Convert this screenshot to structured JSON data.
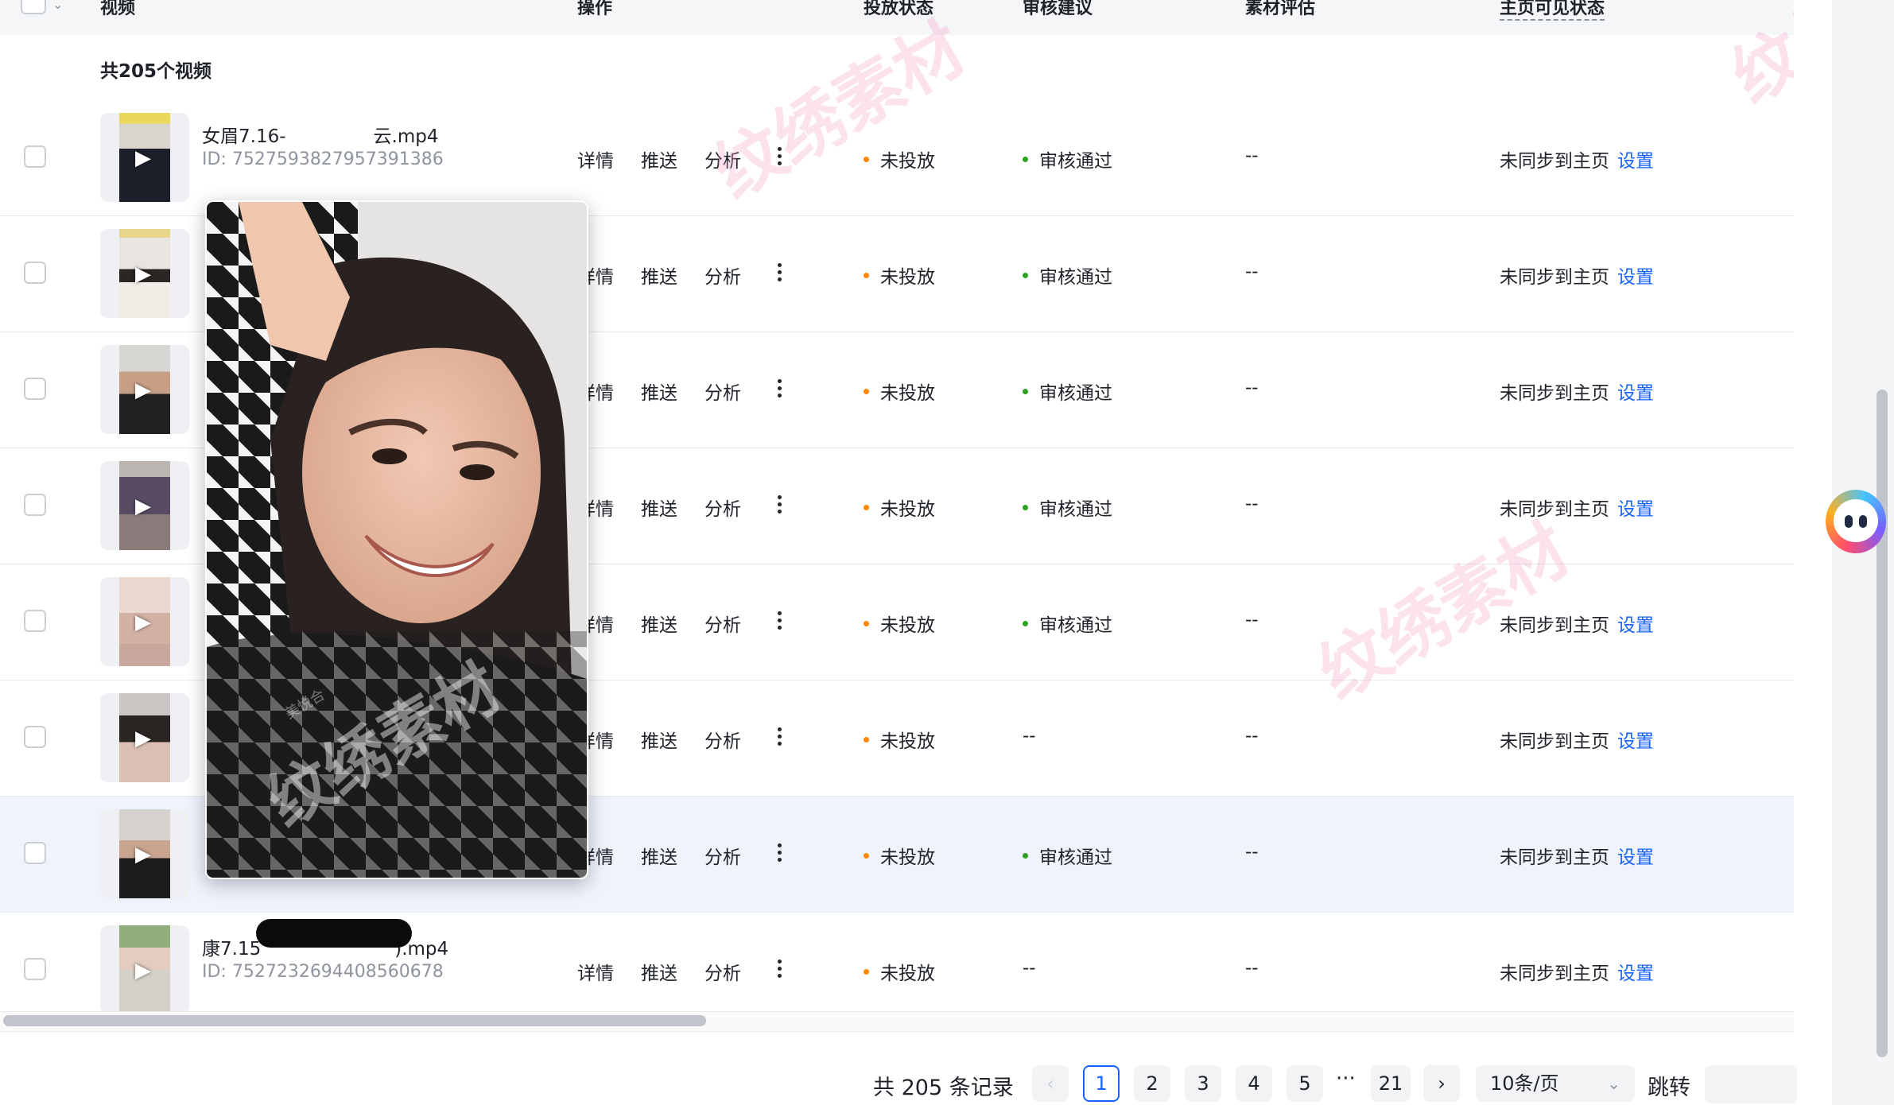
{
  "header": {
    "columns": [
      "视频",
      "操作",
      "投放状态",
      "审核建议",
      "素材评估",
      "主页可见状态"
    ]
  },
  "summary": "共205个视频",
  "actions": {
    "detail": "详情",
    "push": "推送",
    "analysis": "分析"
  },
  "rows": [
    {
      "filename": "女眉7.16-",
      "filename_tail": "云.mp4",
      "id": "ID: 7527593827957391386",
      "delivery": "未投放",
      "review": "审核通过",
      "eval": "--",
      "sync": "未同步到主页",
      "set": "设置"
    },
    {
      "filename": "",
      "id": "",
      "delivery": "未投放",
      "review": "审核通过",
      "eval": "--",
      "sync": "未同步到主页",
      "set": "设置"
    },
    {
      "filename": "",
      "id": "",
      "delivery": "未投放",
      "review": "审核通过",
      "eval": "--",
      "sync": "未同步到主页",
      "set": "设置"
    },
    {
      "filename": "",
      "id": "",
      "delivery": "未投放",
      "review": "审核通过",
      "eval": "--",
      "sync": "未同步到主页",
      "set": "设置"
    },
    {
      "filename": "",
      "id": "",
      "delivery": "未投放",
      "review": "审核通过",
      "eval": "--",
      "sync": "未同步到主页",
      "set": "设置"
    },
    {
      "filename": "",
      "id": "",
      "delivery": "未投放",
      "review": "--",
      "eval": "--",
      "sync": "未同步到主页",
      "set": "设置"
    },
    {
      "filename": "",
      "id": "",
      "delivery": "未投放",
      "review": "审核通过",
      "eval": "--",
      "sync": "未同步到主页",
      "set": "设置"
    },
    {
      "filename": "康7.15",
      "filename_tail": ").mp4",
      "id": "ID: 7527232694408560678",
      "delivery": "未投放",
      "review": "--",
      "eval": "--",
      "sync": "未同步到主页",
      "set": "设置"
    }
  ],
  "pagination": {
    "total": "共 205 条记录",
    "pages": [
      "1",
      "2",
      "3",
      "4",
      "5",
      "21"
    ],
    "ellipsis": "···",
    "current": "1",
    "page_size": "10条/页",
    "jump_label": "跳转"
  },
  "watermark": "纹绣素材",
  "preview_watermark": "美悦合",
  "colors": {
    "link": "#1664ff",
    "orange_dot": "#ff8800",
    "green_dot": "#2ea121",
    "highlight_row": "#eef3fd"
  },
  "icons": [
    "checkbox-icon",
    "play-icon",
    "more-vertical-icon",
    "chevron-left-icon",
    "chevron-right-icon",
    "chevron-down-icon",
    "ai-assistant-icon"
  ]
}
